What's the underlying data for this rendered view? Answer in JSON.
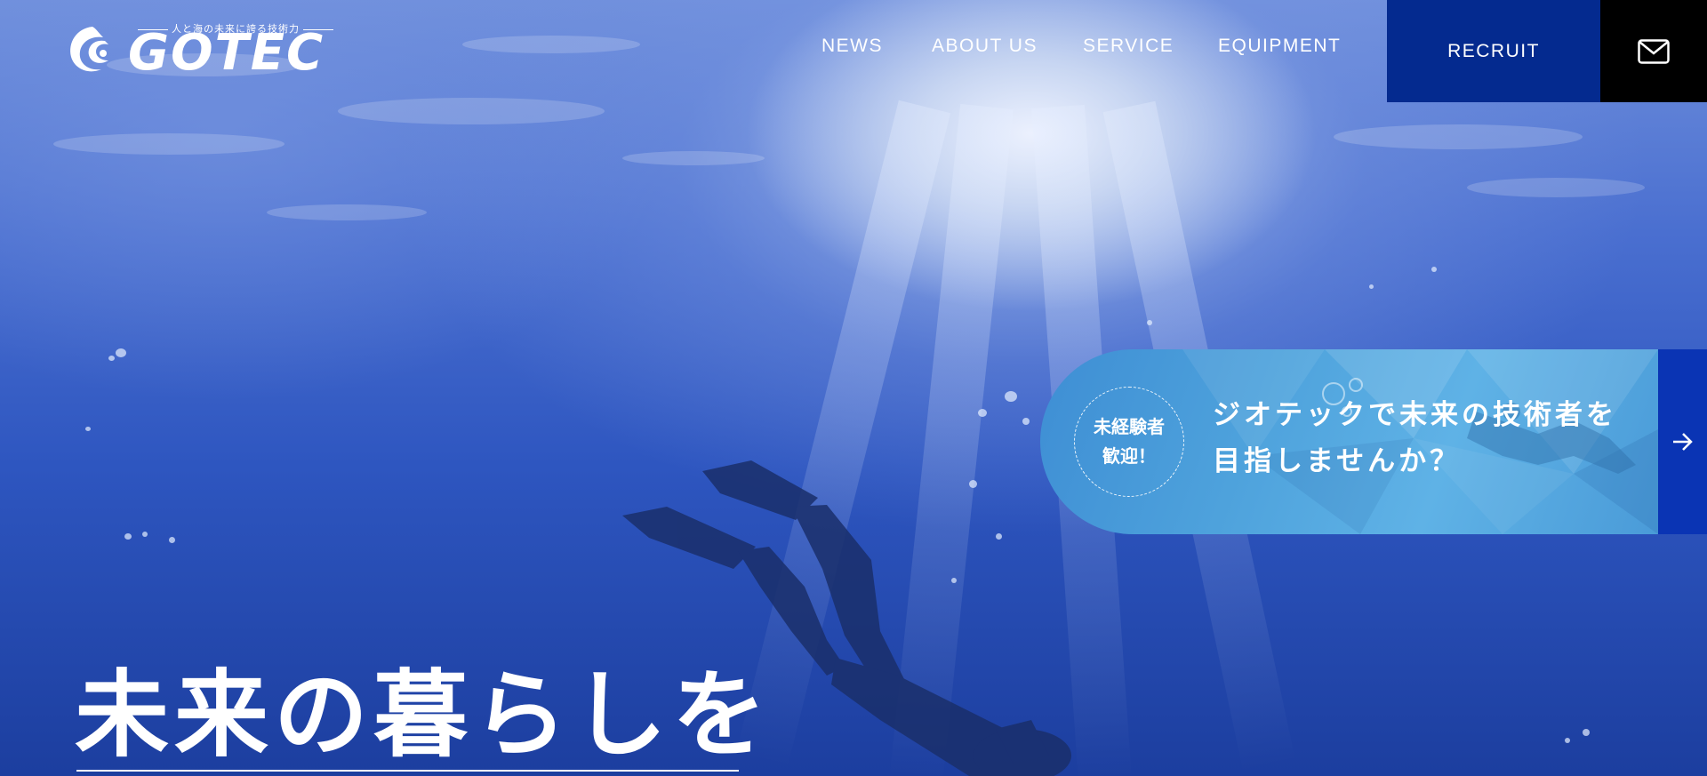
{
  "logo": {
    "tagline": "人と海の未来に誇る技術力",
    "wordmark": "GOTEC"
  },
  "nav": {
    "items": [
      {
        "label": "NEWS"
      },
      {
        "label": "ABOUT US"
      },
      {
        "label": "SERVICE"
      },
      {
        "label": "EQUIPMENT"
      }
    ],
    "recruit_label": "RECRUIT",
    "mail_icon": "mail-icon"
  },
  "banner": {
    "badge_line1": "未経験者",
    "badge_line2": "歓迎！",
    "text_line1": "ジオテックで未来の技術者を",
    "text_line2": "目指しませんか？",
    "arrow_icon": "arrow-right-icon"
  },
  "hero": {
    "headline": "未来の暮らしを"
  },
  "colors": {
    "recruit_bg": "#042a8f",
    "mail_bg": "#000000",
    "banner_arrow_bg": "#0a34b4"
  }
}
